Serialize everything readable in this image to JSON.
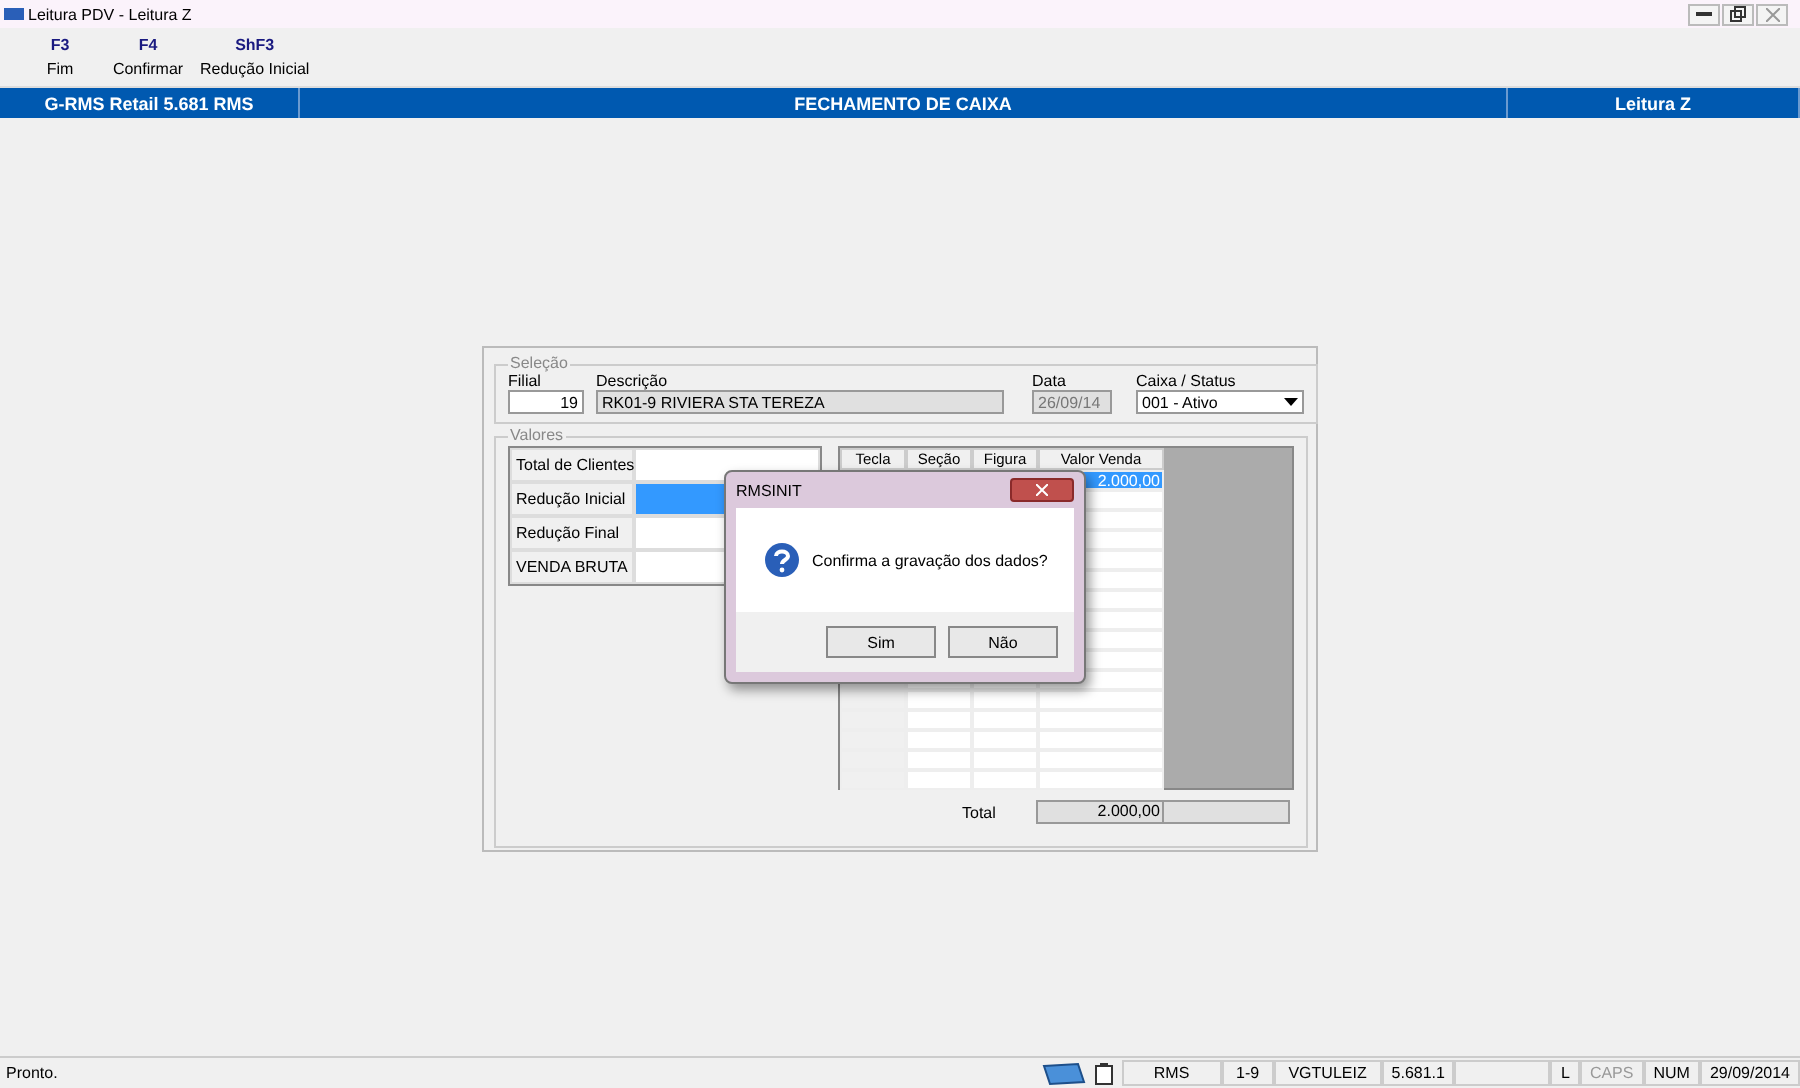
{
  "window": {
    "title": "Leitura PDV - Leitura Z"
  },
  "toolbar": [
    {
      "key": "F3",
      "label": "Fim"
    },
    {
      "key": "F4",
      "label": "Confirmar"
    },
    {
      "key": "ShF3",
      "label": "Redução Inicial"
    }
  ],
  "header": {
    "left": "G-RMS Retail 5.681 RMS",
    "center": "FECHAMENTO DE CAIXA",
    "right": "Leitura Z"
  },
  "selecao": {
    "legend": "Seleção",
    "filial_label": "Filial",
    "filial": "19",
    "descricao_label": "Descrição",
    "descricao": "RK01-9 RIVIERA STA TEREZA",
    "data_label": "Data",
    "data": "26/09/14",
    "caixa_label": "Caixa / Status",
    "caixa": "001  - Ativo"
  },
  "valores": {
    "legend": "Valores",
    "rows": [
      {
        "label": "Total de Clientes",
        "selected": false
      },
      {
        "label": "Redução Inicial",
        "selected": true
      },
      {
        "label": "Redução Final",
        "selected": false
      },
      {
        "label": "VENDA BRUTA",
        "selected": false
      }
    ],
    "grid": {
      "columns": [
        "Tecla",
        "Seção",
        "Figura",
        "Valor Venda"
      ],
      "rows": [
        {
          "valor": "2.000,00",
          "selected": true
        }
      ]
    },
    "total_label": "Total",
    "total": "2.000,00"
  },
  "dialog": {
    "title": "RMSINIT",
    "message": "Confirma a gravação dos dados?",
    "buttons": [
      "Sim",
      "Não"
    ]
  },
  "status_bar": {
    "message": "Pronto.",
    "panels": [
      "RMS",
      "1-9",
      "VGTULEIZ",
      "5.681.1",
      "L",
      "CAPS",
      "NUM",
      "29/09/2014"
    ]
  }
}
